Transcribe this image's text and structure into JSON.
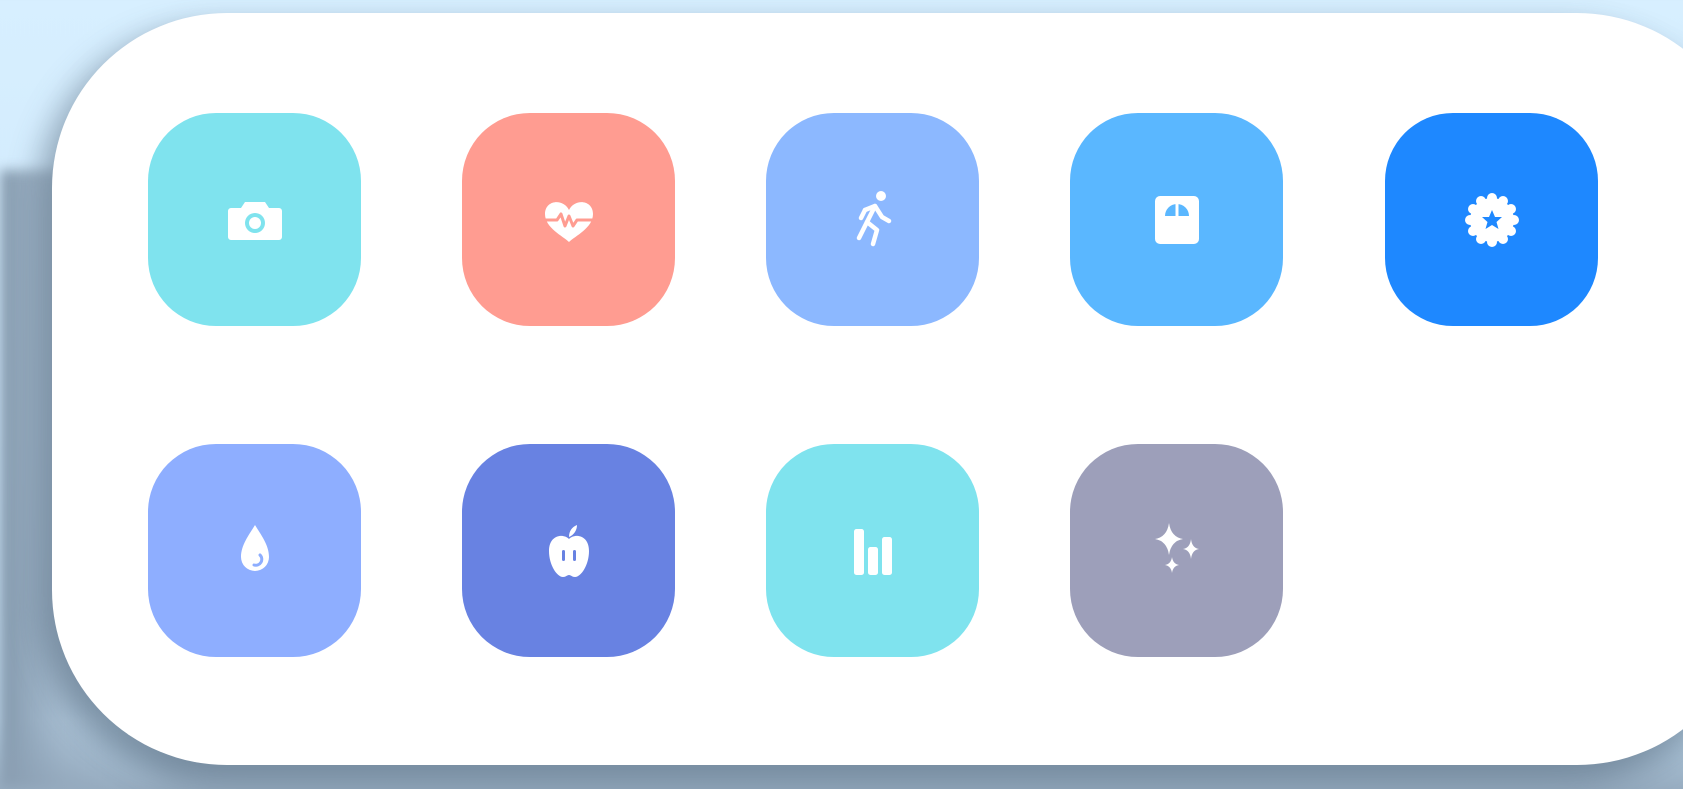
{
  "tiles": [
    {
      "icon": "camera-icon",
      "color": "#7fe3ee"
    },
    {
      "icon": "heart-rate-icon",
      "color": "#ff9c91"
    },
    {
      "icon": "running-icon",
      "color": "#8cb8ff"
    },
    {
      "icon": "scale-icon",
      "color": "#5ab7ff"
    },
    {
      "icon": "badge-star-icon",
      "color": "#1e88ff"
    },
    {
      "icon": "water-drop-icon",
      "color": "#8eaeff"
    },
    {
      "icon": "apple-icon",
      "color": "#6882e2"
    },
    {
      "icon": "bar-chart-icon",
      "color": "#7fe3ee"
    },
    {
      "icon": "sparkles-icon",
      "color": "#9d9fba"
    }
  ]
}
